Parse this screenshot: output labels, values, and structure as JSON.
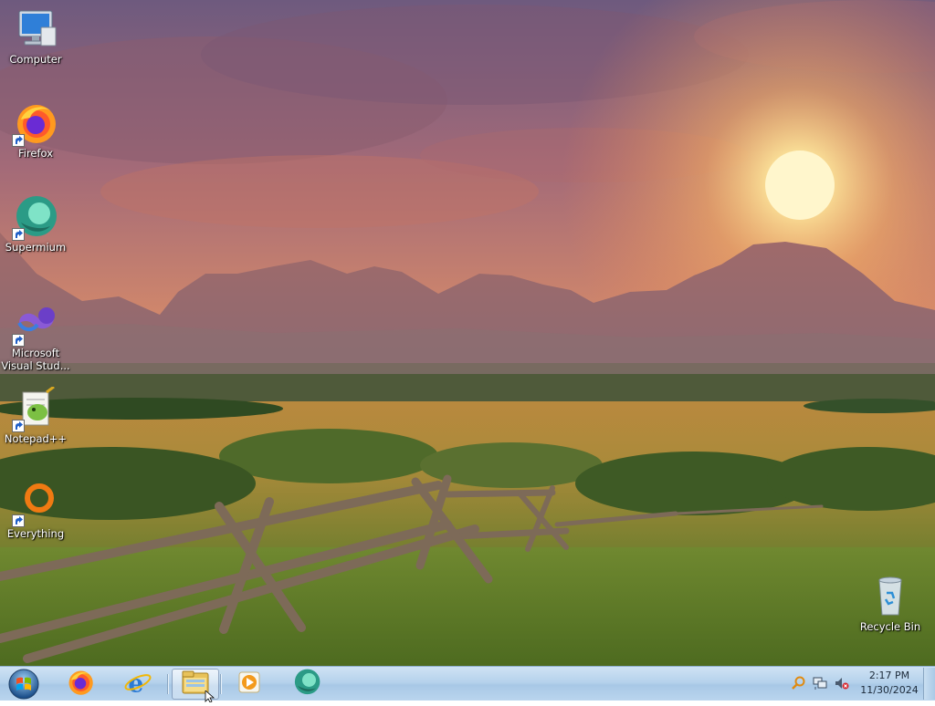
{
  "desktop": {
    "icons": [
      {
        "label": "Computer",
        "icon": "computer-icon"
      },
      {
        "label": "Firefox",
        "icon": "firefox-icon"
      },
      {
        "label": "Supermium",
        "icon": "supermium-icon"
      },
      {
        "label": "Microsoft Visual Stud...",
        "icon": "visual-studio-icon"
      },
      {
        "label": "Notepad++",
        "icon": "notepadpp-icon"
      },
      {
        "label": "Everything",
        "icon": "everything-icon"
      },
      {
        "label": "Recycle Bin",
        "icon": "recycle-bin-icon"
      }
    ]
  },
  "taskbar": {
    "pinned": [
      {
        "name": "Firefox",
        "icon": "firefox-icon"
      },
      {
        "name": "Internet Explorer",
        "icon": "internet-explorer-icon"
      },
      {
        "name": "Windows Explorer",
        "icon": "folder-icon",
        "active": true
      },
      {
        "name": "Windows Media Player",
        "icon": "media-player-icon"
      },
      {
        "name": "Supermium",
        "icon": "supermium-icon"
      }
    ],
    "tray": {
      "icons": [
        "search-icon",
        "network-icon",
        "volume-muted-icon"
      ],
      "time": "2:17 PM",
      "date": "11/30/2024"
    }
  },
  "colors": {
    "taskbar": "#b6d2ec",
    "sky_top": "#6e5a7e",
    "sun": "#fff3c0"
  }
}
